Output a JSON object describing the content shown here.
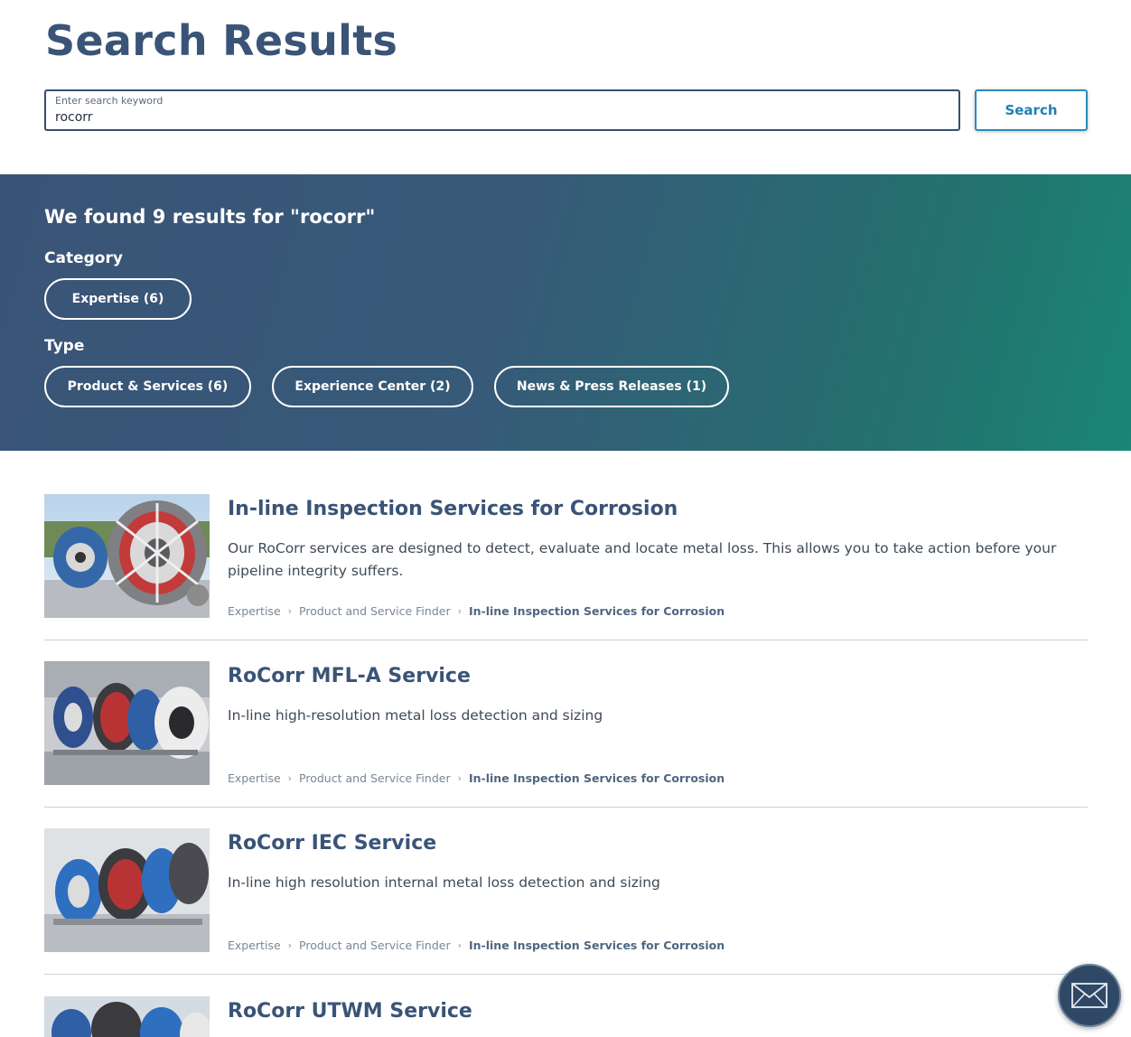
{
  "header": {
    "title": "Search Results"
  },
  "search": {
    "placeholder": "Enter search keyword",
    "value": "rocorr",
    "button_label": "Search"
  },
  "banner": {
    "found_text": "We found 9 results for \"rocorr\"",
    "category_heading": "Category",
    "category_chips": [
      "Expertise (6)"
    ],
    "type_heading": "Type",
    "type_chips": [
      "Product & Services (6)",
      "Experience Center (2)",
      "News & Press Releases (1)"
    ]
  },
  "results": [
    {
      "title": "In-line Inspection Services for Corrosion",
      "description": "Our RoCorr services are designed to detect, evaluate and locate metal loss. This allows you to take action before your pipeline integrity suffers.",
      "breadcrumb": [
        "Expertise",
        "Product and Service Finder",
        "In-line Inspection Services for Corrosion"
      ]
    },
    {
      "title": "RoCorr MFL-A Service",
      "description": "In-line high-resolution metal loss detection and sizing",
      "breadcrumb": [
        "Expertise",
        "Product and Service Finder",
        "In-line Inspection Services for Corrosion"
      ]
    },
    {
      "title": "RoCorr IEC Service",
      "description": "In-line high resolution internal metal loss detection and sizing",
      "breadcrumb": [
        "Expertise",
        "Product and Service Finder",
        "In-line Inspection Services for Corrosion"
      ]
    },
    {
      "title": "RoCorr UTWM Service",
      "description": "",
      "breadcrumb": []
    }
  ],
  "colors": {
    "primary": "#3a5477",
    "accent": "#1f7fb3",
    "banner_start": "#3a5477",
    "banner_end": "#1a8675"
  },
  "icons": {
    "contact_fab": "envelope-icon"
  }
}
